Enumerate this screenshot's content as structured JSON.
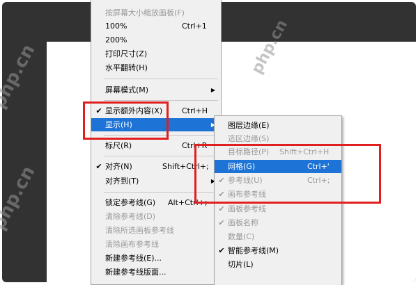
{
  "watermark": "php.cn",
  "view_menu": {
    "items": [
      {
        "label": "按屏幕大小缩放画板(F)",
        "shortcut": "",
        "checked": false,
        "disabled": true,
        "submenu": false
      },
      {
        "label": "100%",
        "shortcut": "Ctrl+1",
        "checked": false,
        "disabled": false,
        "submenu": false
      },
      {
        "label": "200%",
        "shortcut": "",
        "checked": false,
        "disabled": false,
        "submenu": false
      },
      {
        "label": "打印尺寸(Z)",
        "shortcut": "",
        "checked": false,
        "disabled": false,
        "submenu": false
      },
      {
        "label": "水平翻转(H)",
        "shortcut": "",
        "checked": false,
        "disabled": false,
        "submenu": false
      },
      {
        "label": "屏幕模式(M)",
        "shortcut": "",
        "checked": false,
        "disabled": false,
        "submenu": true
      },
      {
        "label": "显示额外内容(X)",
        "shortcut": "Ctrl+H",
        "checked": true,
        "disabled": false,
        "submenu": false
      },
      {
        "label": "显示(H)",
        "shortcut": "",
        "checked": false,
        "disabled": false,
        "submenu": true,
        "highlighted": true
      },
      {
        "label": "标尺(R)",
        "shortcut": "Ctrl+R",
        "checked": false,
        "disabled": false,
        "submenu": false
      },
      {
        "label": "对齐(N)",
        "shortcut": "Shift+Ctrl+;",
        "checked": true,
        "disabled": false,
        "submenu": false
      },
      {
        "label": "对齐到(T)",
        "shortcut": "",
        "checked": false,
        "disabled": false,
        "submenu": true
      },
      {
        "label": "锁定参考线(G)",
        "shortcut": "Alt+Ctrl+;",
        "checked": false,
        "disabled": false,
        "submenu": false
      },
      {
        "label": "清除参考线(D)",
        "shortcut": "",
        "checked": false,
        "disabled": true,
        "submenu": false
      },
      {
        "label": "清除所选画板参考线",
        "shortcut": "",
        "checked": false,
        "disabled": true,
        "submenu": false
      },
      {
        "label": "清除画布参考线",
        "shortcut": "",
        "checked": false,
        "disabled": true,
        "submenu": false
      },
      {
        "label": "新建参考线(E)...",
        "shortcut": "",
        "checked": false,
        "disabled": false,
        "submenu": false
      },
      {
        "label": "新建参考线版面...",
        "shortcut": "",
        "checked": false,
        "disabled": false,
        "submenu": false
      }
    ]
  },
  "show_submenu": {
    "items": [
      {
        "label": "图层边缘(E)",
        "shortcut": "",
        "checked": false,
        "disabled": false
      },
      {
        "label": "选区边缘(S)",
        "shortcut": "",
        "checked": false,
        "disabled": true
      },
      {
        "label": "目标路径(P)",
        "shortcut": "Shift+Ctrl+H",
        "checked": false,
        "disabled": true
      },
      {
        "label": "网格(G)",
        "shortcut": "Ctrl+'",
        "checked": false,
        "disabled": false,
        "highlighted": true
      },
      {
        "label": "参考线(U)",
        "shortcut": "Ctrl+;",
        "checked": true,
        "disabled": true
      },
      {
        "label": "画布参考线",
        "shortcut": "",
        "checked": true,
        "disabled": true
      },
      {
        "label": "画板参考线",
        "shortcut": "",
        "checked": true,
        "disabled": true
      },
      {
        "label": "画板名称",
        "shortcut": "",
        "checked": true,
        "disabled": true
      },
      {
        "label": "数量(C)",
        "shortcut": "",
        "checked": false,
        "disabled": true
      },
      {
        "label": "智能参考线(M)",
        "shortcut": "",
        "checked": true,
        "disabled": false
      },
      {
        "label": "切片(L)",
        "shortcut": "",
        "checked": false,
        "disabled": false
      }
    ]
  },
  "colors": {
    "highlight": "#1e74d6",
    "annotation_box": "#e01f1f",
    "background": "#323232"
  }
}
